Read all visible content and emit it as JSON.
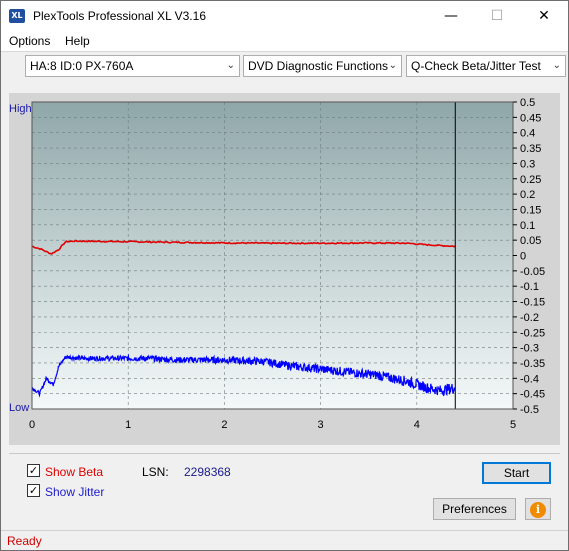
{
  "window": {
    "title": "PlexTools Professional XL V3.16",
    "app_icon_text": "XL",
    "minimize_glyph": "—",
    "maximize_glyph": "☐",
    "close_glyph": "✕"
  },
  "menu": {
    "options": "Options",
    "help": "Help"
  },
  "toolbar": {
    "drive": "HA:8 ID:0  PX-760A",
    "function": "DVD Diagnostic Functions",
    "test": "Q-Check Beta/Jitter Test",
    "dropdown_glyph": "⌄"
  },
  "chart_data": {
    "type": "line",
    "left_axis_labels": [
      "High",
      "Low"
    ],
    "x_ticks": [
      "0",
      "1",
      "2",
      "3",
      "4",
      "5"
    ],
    "y_ticks": [
      "0.5",
      "0.45",
      "0.4",
      "0.35",
      "0.3",
      "0.25",
      "0.2",
      "0.15",
      "0.1",
      "0.05",
      "0",
      "-0.05",
      "-0.1",
      "-0.15",
      "-0.2",
      "-0.25",
      "-0.3",
      "-0.35",
      "-0.4",
      "-0.45",
      "-0.5"
    ],
    "xlim": [
      0,
      5
    ],
    "ylim": [
      -0.5,
      0.5
    ],
    "grid": true,
    "end_marker_x": 4.4,
    "series": [
      {
        "color": "#e00000",
        "x": [
          0.0,
          0.1,
          0.2,
          0.28,
          0.35,
          0.45,
          0.7,
          1.0,
          1.5,
          2.0,
          2.5,
          3.0,
          3.5,
          3.9,
          4.1,
          4.4
        ],
        "y": [
          0.03,
          0.02,
          0.005,
          0.02,
          0.045,
          0.047,
          0.046,
          0.045,
          0.043,
          0.041,
          0.04,
          0.04,
          0.041,
          0.04,
          0.035,
          0.03
        ]
      },
      {
        "color": "#0000ff",
        "x": [
          0.0,
          0.08,
          0.15,
          0.22,
          0.28,
          0.35,
          0.5,
          0.8,
          1.2,
          1.5,
          2.0,
          2.4,
          2.7,
          3.0,
          3.3,
          3.6,
          3.9,
          4.1,
          4.25,
          4.4
        ],
        "y": [
          -0.43,
          -0.45,
          -0.4,
          -0.42,
          -0.36,
          -0.33,
          -0.335,
          -0.335,
          -0.335,
          -0.34,
          -0.34,
          -0.345,
          -0.36,
          -0.37,
          -0.38,
          -0.39,
          -0.41,
          -0.43,
          -0.44,
          -0.43
        ]
      }
    ]
  },
  "options": {
    "show_beta_check": "✓",
    "show_beta": "Show Beta",
    "show_jitter_check": "✓",
    "show_jitter": "Show Jitter",
    "lsn_label": "LSN:",
    "lsn_value": "2298368"
  },
  "buttons": {
    "start": "Start",
    "preferences": "Preferences",
    "info": "i"
  },
  "status": {
    "text": "Ready"
  }
}
